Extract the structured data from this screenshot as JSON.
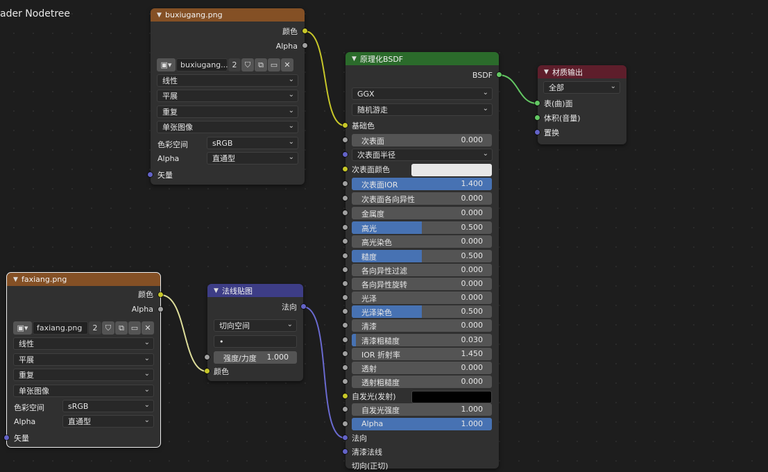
{
  "editor_title": "ader Nodetree",
  "colors": {
    "image_header": "#845025",
    "bsdf_header": "#2b6b2b",
    "normal_header": "#3d3d86",
    "output_header": "#5e1e2b",
    "socket_color": "#c7c729",
    "socket_float": "#a1a1a1",
    "socket_vector": "#6363c7",
    "socket_shader": "#63c763",
    "slider_fill": "#4772b3"
  },
  "image_node_1": {
    "title": "buxiugang.png",
    "out_color": "颜色",
    "out_alpha": "Alpha",
    "image_name": "buxiugang....",
    "users": "2",
    "interpolation": "线性",
    "projection": "平展",
    "extension": "重复",
    "source": "单张图像",
    "colorspace_label": "色彩空间",
    "colorspace_value": "sRGB",
    "alpha_label": "Alpha",
    "alpha_value": "直通型",
    "in_vector": "矢量"
  },
  "image_node_2": {
    "title": "faxiang.png",
    "out_color": "颜色",
    "out_alpha": "Alpha",
    "image_name": "faxiang.png",
    "users": "2",
    "interpolation": "线性",
    "projection": "平展",
    "extension": "重复",
    "source": "单张图像",
    "colorspace_label": "色彩空间",
    "colorspace_value": "sRGB",
    "alpha_label": "Alpha",
    "alpha_value": "直通型",
    "in_vector": "矢量"
  },
  "normal_map": {
    "title": "法线贴图",
    "out_normal": "法向",
    "space": "切向空间",
    "uv_map": "•",
    "strength_label": "强度/力度",
    "strength_value": "1.000",
    "in_color": "颜色"
  },
  "bsdf": {
    "title": "原理化BSDF",
    "out_bsdf": "BSDF",
    "distribution": "GGX",
    "subsurface_method": "随机游走",
    "base_color": "基础色",
    "subsurface": {
      "label": "次表面",
      "value": "0.000"
    },
    "subsurface_radius": "次表面半径",
    "subsurface_color": "次表面颜色",
    "subsurface_color_hex": "#e8e8e8",
    "subsurface_ior": {
      "label": "次表面IOR",
      "value": "1.400",
      "fill": 1.0
    },
    "subsurface_anisotropy": {
      "label": "次表面各向异性",
      "value": "0.000"
    },
    "metallic": {
      "label": "金属度",
      "value": "0.000"
    },
    "specular": {
      "label": "高光",
      "value": "0.500",
      "fill": 0.5
    },
    "specular_tint": {
      "label": "高光染色",
      "value": "0.000"
    },
    "roughness": {
      "label": "糙度",
      "value": "0.500",
      "fill": 0.5
    },
    "anisotropic": {
      "label": "各向异性过滤",
      "value": "0.000"
    },
    "anisotropic_rotation": {
      "label": "各向异性旋转",
      "value": "0.000"
    },
    "sheen": {
      "label": "光泽",
      "value": "0.000"
    },
    "sheen_tint": {
      "label": "光泽染色",
      "value": "0.500",
      "fill": 0.5
    },
    "clearcoat": {
      "label": "清漆",
      "value": "0.000"
    },
    "clearcoat_roughness": {
      "label": "清漆粗糙度",
      "value": "0.030",
      "fill": 0.03
    },
    "ior": {
      "label": "IOR 折射率",
      "value": "1.450"
    },
    "transmission": {
      "label": "透射",
      "value": "0.000"
    },
    "transmission_roughness": {
      "label": "透射粗糙度",
      "value": "0.000"
    },
    "emission": "自发光(发射)",
    "emission_color_hex": "#000000",
    "emission_strength": {
      "label": "自发光强度",
      "value": "1.000"
    },
    "alpha": {
      "label": "Alpha",
      "value": "1.000",
      "fill": 1.0
    },
    "normal": "法向",
    "clearcoat_normal": "清漆法线",
    "tangent": "切向(正切)"
  },
  "material_output": {
    "title": "材质输出",
    "target": "全部",
    "surface": "表(曲)面",
    "volume": "体积(音量)",
    "displacement": "置换"
  }
}
